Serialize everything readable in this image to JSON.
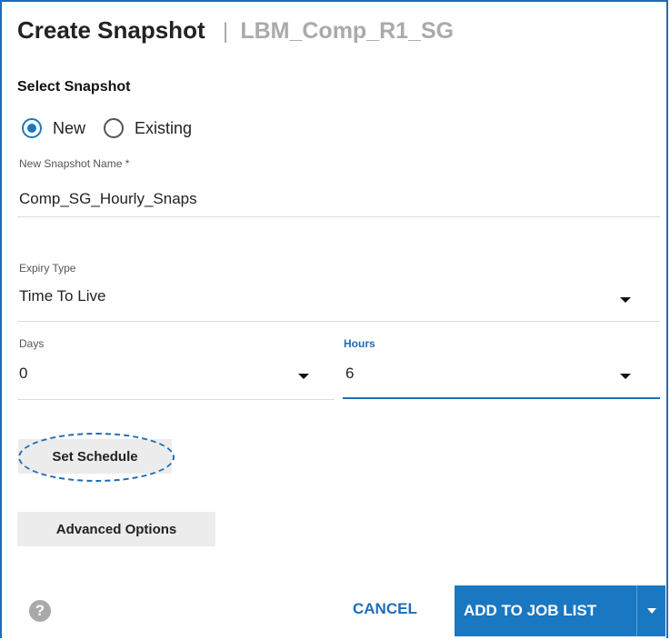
{
  "header": {
    "title": "Create Snapshot",
    "separator": "|",
    "subtitle": "LBM_Comp_R1_SG"
  },
  "select_snapshot": {
    "label": "Select Snapshot",
    "options": [
      {
        "label": "New",
        "checked": true
      },
      {
        "label": "Existing",
        "checked": false
      }
    ]
  },
  "snapshot_name": {
    "label": "New Snapshot Name *",
    "value": "Comp_SG_Hourly_Snaps"
  },
  "expiry_type": {
    "label": "Expiry Type",
    "value": "Time To Live"
  },
  "days": {
    "label": "Days",
    "value": "0"
  },
  "hours": {
    "label": "Hours",
    "value": "6"
  },
  "buttons": {
    "set_schedule": "Set Schedule",
    "advanced_options": "Advanced Options",
    "help": "?",
    "cancel": "CANCEL",
    "add_to_job_list": "ADD TO JOB LIST"
  },
  "colors": {
    "accent": "#1e6db8",
    "primary_button": "#1a78c2",
    "secondary_button": "#ececec"
  },
  "icons": {
    "help": "question-circle-icon",
    "dropdown": "caret-down-icon"
  }
}
